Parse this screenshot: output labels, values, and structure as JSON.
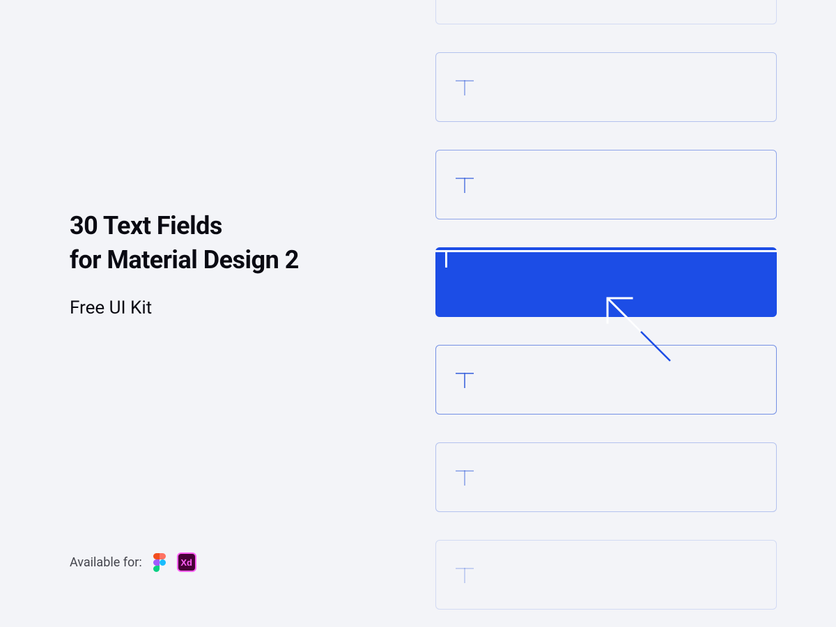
{
  "headline_line1": "30 Text Fields",
  "headline_line2": "for Material Design 2",
  "subhead": "Free UI Kit",
  "available_label": "Available for:",
  "icons": {
    "xd_text": "Xd"
  }
}
